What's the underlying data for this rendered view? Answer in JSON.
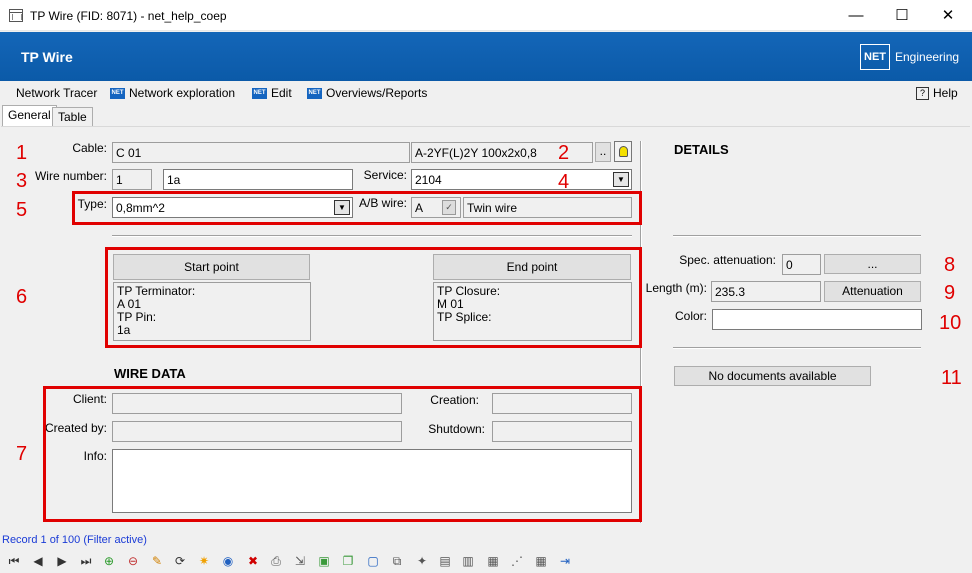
{
  "window": {
    "title": "TP Wire (FID: 8071) - net_help_coep",
    "minimize": "—",
    "maximize": "☐",
    "close": "✕"
  },
  "banner": {
    "title": "TP Wire",
    "logo": "NET",
    "brand": "Engineering",
    "color": "#0b5aa8"
  },
  "menu": {
    "items": [
      "Network Tracer",
      "Network exploration",
      "Edit",
      "Overviews/Reports"
    ],
    "help": "Help"
  },
  "tabs": [
    "General",
    "Table"
  ],
  "form": {
    "cable_label": "Cable:",
    "cable_value": "C 01",
    "cable_type": "A-2YF(L)2Y 100x2x0,8",
    "browse": "..",
    "wire_number_label": "Wire number:",
    "wire_number_a": "1",
    "wire_number_b": "1a",
    "service_label": "Service:",
    "service_value": "2104",
    "type_label": "Type:",
    "type_value": "0,8mm^2",
    "ab_label": "A/B wire:",
    "ab_value": "A",
    "twin": "Twin wire",
    "start_button": "Start point",
    "start_text": "TP Terminator:\nA 01\nTP Pin:\n1a",
    "end_button": "End point",
    "end_text": "TP Closure:\nM 01\nTP Splice:",
    "wire_data_title": "WIRE DATA",
    "client_label": "Client:",
    "creation_label": "Creation:",
    "created_by_label": "Created by:",
    "shutdown_label": "Shutdown:",
    "info_label": "Info:"
  },
  "details": {
    "title": "DETAILS",
    "spec_att_label": "Spec. attenuation:",
    "spec_att_value": "0",
    "spec_att_button": "...",
    "length_label": "Length (m):",
    "length_value": "235.3",
    "attenuation_button": "Attenuation",
    "color_label": "Color:",
    "no_docs": "No documents available"
  },
  "annotations": [
    "1",
    "2",
    "3",
    "4",
    "5",
    "6",
    "7",
    "8",
    "9",
    "10",
    "11"
  ],
  "status": {
    "record": "Record 1 of 100 (Filter active)"
  },
  "toolbar_icons": [
    "first-icon",
    "prev-icon",
    "next-icon",
    "last-icon",
    "filter-add-icon",
    "filter-remove-icon",
    "pencil-icon",
    "refresh-icon",
    "sun-icon",
    "globe-icon",
    "delete-icon",
    "print-icon",
    "select-icon",
    "box-icon",
    "copy-icon",
    "frame-icon",
    "duplicate-icon",
    "new-icon",
    "report-icon",
    "report2-icon",
    "report3-icon",
    "network-icon",
    "table-icon",
    "exit-icon"
  ],
  "toolbar_glyphs": [
    "⏮",
    "◀",
    "▶",
    "⏭",
    "⊕",
    "⊖",
    "✎",
    "⟳",
    "✷",
    "◉",
    "✖",
    "⎙",
    "⇲",
    "▣",
    "❐",
    "▢",
    "⧉",
    "✦",
    "▤",
    "▥",
    "▦",
    "⋰",
    "▦",
    "⇥"
  ]
}
